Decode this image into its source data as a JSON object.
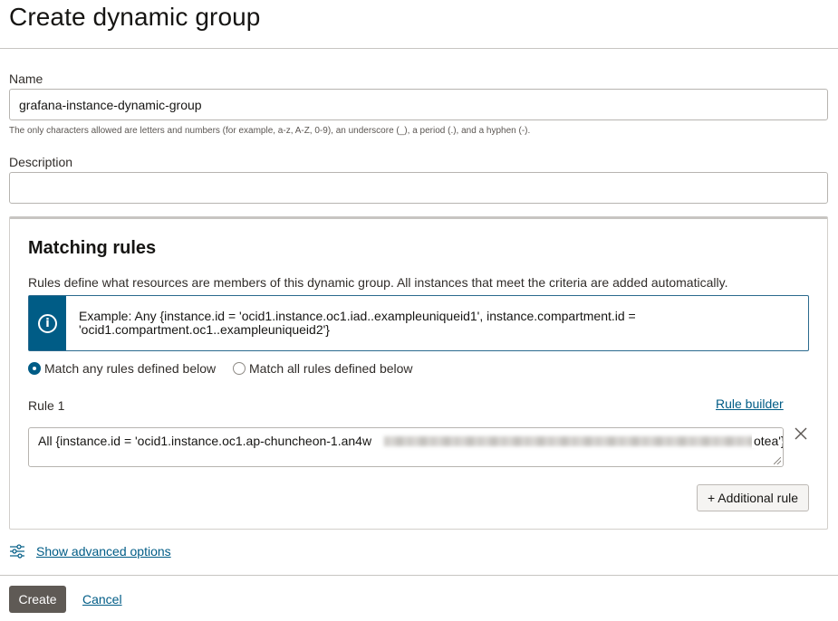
{
  "page": {
    "title": "Create dynamic group"
  },
  "form": {
    "name_label": "Name",
    "name_value": "grafana-instance-dynamic-group",
    "name_help": "The only characters allowed are letters and numbers (for example, a-z, A-Z, 0-9), an underscore (_), a period (.), and a hyphen (-).",
    "description_label": "Description",
    "description_value": ""
  },
  "matching_rules": {
    "title": "Matching rules",
    "description": "Rules define what resources are members of this dynamic group. All instances that meet the criteria are added automatically.",
    "example": "Example: Any {instance.id = 'ocid1.instance.oc1.iad..exampleuniqueid1', instance.compartment.id = 'ocid1.compartment.oc1..exampleuniqueid2'}",
    "match_options": [
      {
        "label": "Match any rules defined below",
        "selected": true
      },
      {
        "label": "Match all rules defined below",
        "selected": false
      }
    ],
    "rules": [
      {
        "label": "Rule 1",
        "value_visible_start": "All {instance.id = 'ocid1.instance.oc1.ap-chuncheon-1.an4w",
        "value_visible_end": "otea'}",
        "value_redacted": true
      }
    ],
    "rule_builder_label": "Rule builder",
    "additional_rule_label": "+ Additional rule"
  },
  "advanced": {
    "label": "Show advanced options"
  },
  "footer": {
    "create_label": "Create",
    "cancel_label": "Cancel"
  },
  "colors": {
    "link": "#005c86",
    "info_accent": "#005c86",
    "primary_button": "#5f5a55"
  },
  "icons": {
    "info": "info-circle-icon",
    "remove": "close-icon",
    "advanced": "sliders-icon"
  }
}
